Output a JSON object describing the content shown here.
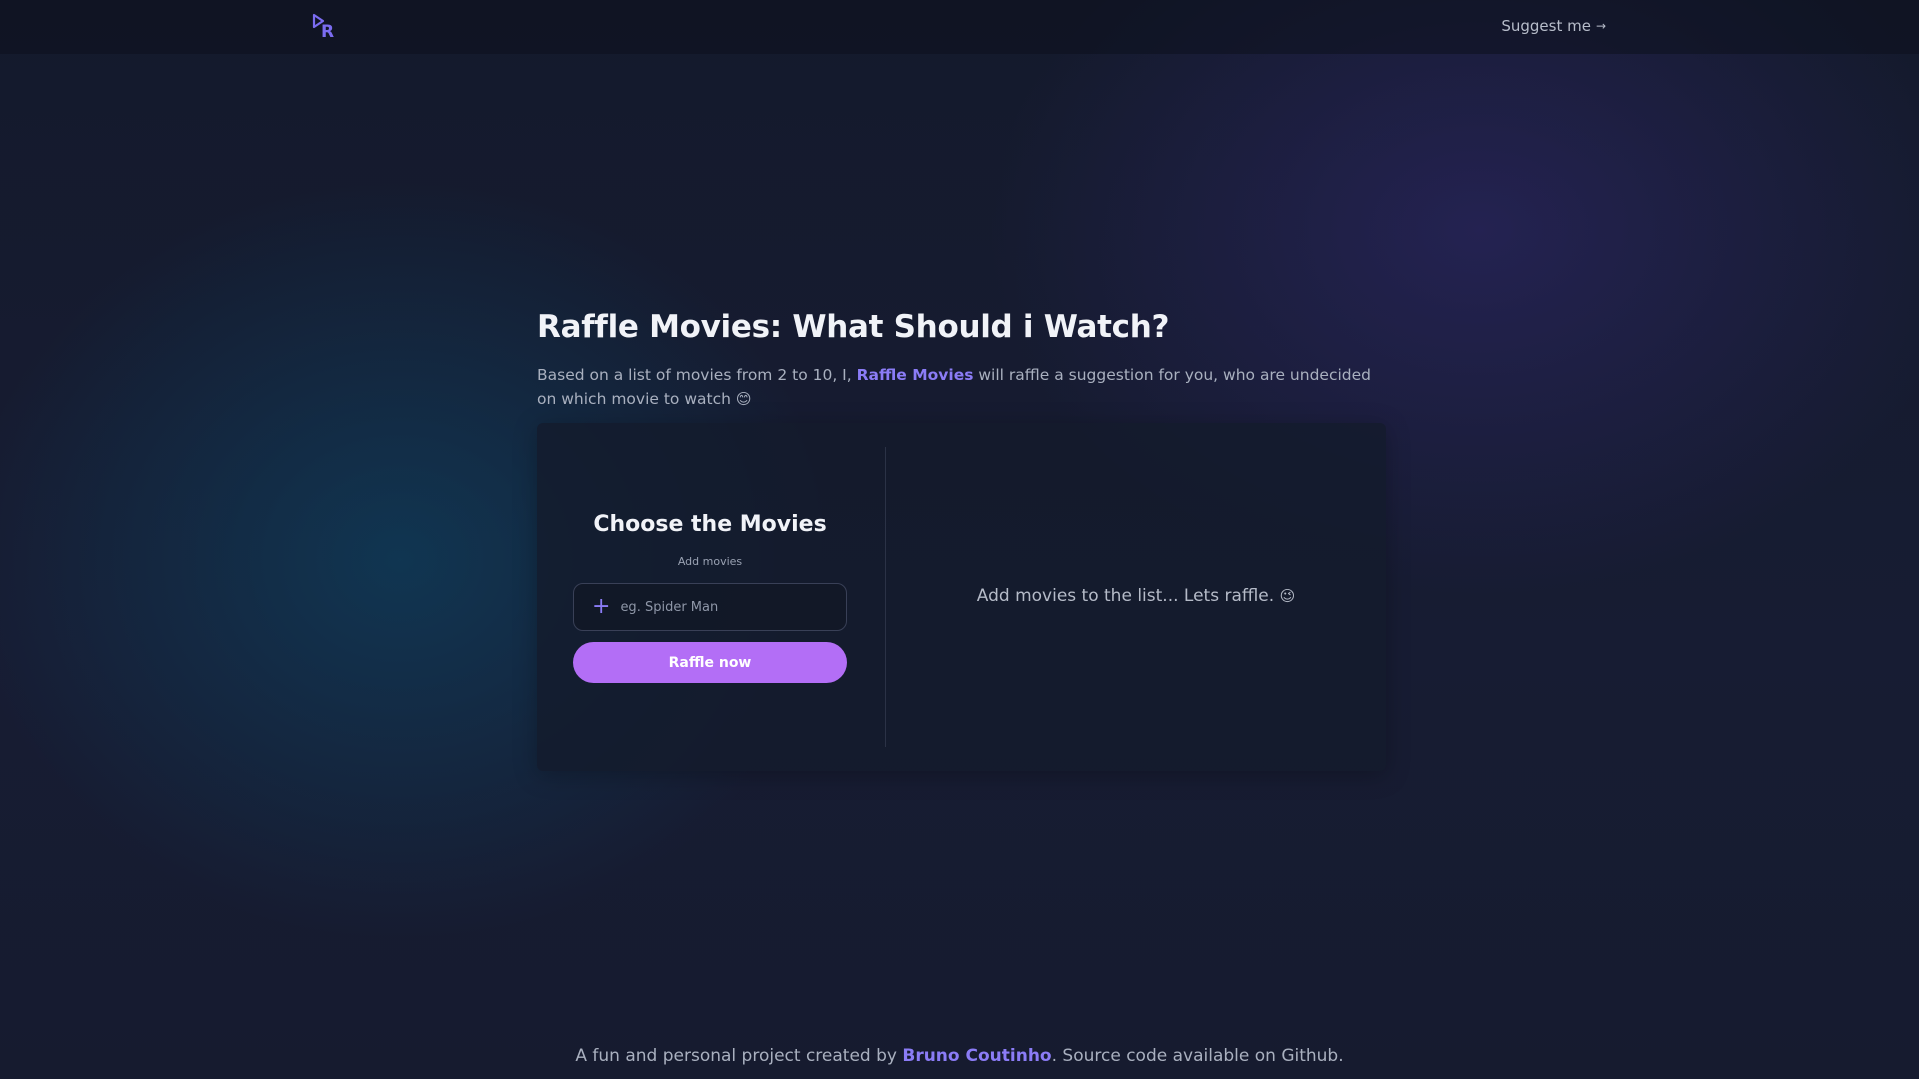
{
  "header": {
    "logo_icon": "play-r-logo-icon",
    "suggest_label": "Suggest me",
    "suggest_arrow": "→"
  },
  "hero": {
    "title": "Raffle Movies: What Should i Watch?",
    "intro_before": "Based on a list of movies from 2 to 10, I, ",
    "intro_brand": "Raffle Movies",
    "intro_after": " will raffle a suggestion for you, who are undecided on which movie to watch ",
    "intro_emoji": "😊"
  },
  "form": {
    "title": "Choose the Movies",
    "add_label": "Add movies",
    "input_placeholder": "eg. Spider Man",
    "input_value": "",
    "plus_icon": "+",
    "raffle_button": "Raffle now"
  },
  "result": {
    "empty_message": "Add movies to the list... Lets raffle. ",
    "empty_emoji": "😉"
  },
  "footer": {
    "before": "A fun and personal project created by ",
    "author": "Bruno Coutinho",
    "after": ". Source code available on Github."
  },
  "colors": {
    "accent": "#8b7cf6",
    "button": "#b36ef6",
    "background": "#151b2e"
  }
}
